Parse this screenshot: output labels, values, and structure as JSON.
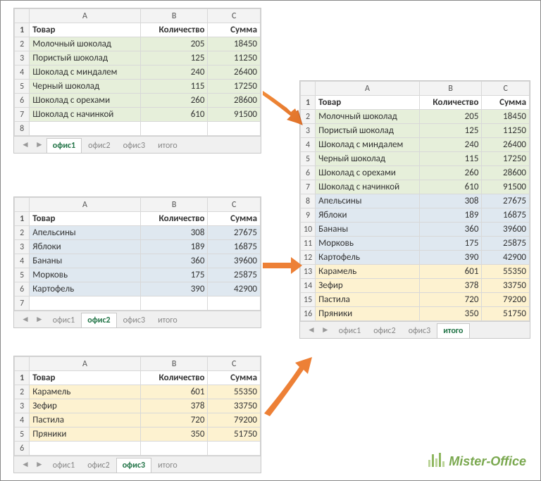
{
  "columns": [
    "A",
    "B",
    "C"
  ],
  "headers": {
    "product": "Товар",
    "qty": "Количество",
    "sum": "Сумма"
  },
  "tabs": [
    "офис1",
    "офис2",
    "офис3",
    "итого"
  ],
  "sheets": {
    "ofis1": {
      "active_tab": "офис1",
      "rows": [
        {
          "p": "Молочный шоколад",
          "q": 205,
          "s": 18450
        },
        {
          "p": "Пористый шоколад",
          "q": 125,
          "s": 11250
        },
        {
          "p": "Шоколад с миндалем",
          "q": 240,
          "s": 26400
        },
        {
          "p": "Черный шоколад",
          "q": 115,
          "s": 17250
        },
        {
          "p": "Шоколад с орехами",
          "q": 260,
          "s": 28600
        },
        {
          "p": "Шоколад с начинкой",
          "q": 610,
          "s": 91500
        }
      ]
    },
    "ofis2": {
      "active_tab": "офис2",
      "rows": [
        {
          "p": "Апельсины",
          "q": 308,
          "s": 27675
        },
        {
          "p": "Яблоки",
          "q": 189,
          "s": 16875
        },
        {
          "p": "Бананы",
          "q": 360,
          "s": 39600
        },
        {
          "p": "Морковь",
          "q": 175,
          "s": 25875
        },
        {
          "p": "Картофель",
          "q": 390,
          "s": 42900
        }
      ]
    },
    "ofis3": {
      "active_tab": "офис3",
      "rows": [
        {
          "p": "Карамель",
          "q": 601,
          "s": 55350
        },
        {
          "p": "Зефир",
          "q": 378,
          "s": 33750
        },
        {
          "p": "Пастила",
          "q": 720,
          "s": 79200
        },
        {
          "p": "Пряники",
          "q": 350,
          "s": 51750
        }
      ]
    },
    "itogo": {
      "active_tab": "итого",
      "rows": [
        {
          "p": "Молочный шоколад",
          "q": 205,
          "s": 18450,
          "c": "green"
        },
        {
          "p": "Пористый шоколад",
          "q": 125,
          "s": 11250,
          "c": "green"
        },
        {
          "p": "Шоколад с миндалем",
          "q": 240,
          "s": 26400,
          "c": "green"
        },
        {
          "p": "Черный шоколад",
          "q": 115,
          "s": 17250,
          "c": "green"
        },
        {
          "p": "Шоколад с орехами",
          "q": 260,
          "s": 28600,
          "c": "green"
        },
        {
          "p": "Шоколад с начинкой",
          "q": 610,
          "s": 91500,
          "c": "green"
        },
        {
          "p": "Апельсины",
          "q": 308,
          "s": 27675,
          "c": "blue"
        },
        {
          "p": "Яблоки",
          "q": 189,
          "s": 16875,
          "c": "blue"
        },
        {
          "p": "Бананы",
          "q": 360,
          "s": 39600,
          "c": "blue"
        },
        {
          "p": "Морковь",
          "q": 175,
          "s": 25875,
          "c": "blue"
        },
        {
          "p": "Картофель",
          "q": 390,
          "s": 42900,
          "c": "blue"
        },
        {
          "p": "Карамель",
          "q": 601,
          "s": 55350,
          "c": "yellow"
        },
        {
          "p": "Зефир",
          "q": 378,
          "s": 33750,
          "c": "yellow"
        },
        {
          "p": "Пастила",
          "q": 720,
          "s": 79200,
          "c": "yellow"
        },
        {
          "p": "Пряники",
          "q": 350,
          "s": 51750,
          "c": "yellow"
        }
      ]
    }
  },
  "logo": {
    "text": "Mister-Office"
  }
}
